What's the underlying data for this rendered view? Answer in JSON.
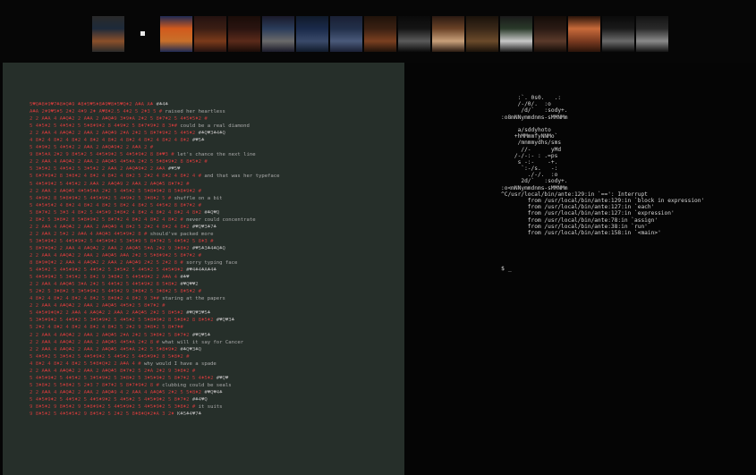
{
  "thumbnails": [
    {
      "name": "thumb-1",
      "colors": [
        "#1d2a3a",
        "#8a4f2a",
        "#2a2a2a"
      ]
    },
    {
      "name": "thumb-2",
      "colors": [
        "#060606",
        "#060606",
        "#060606"
      ]
    },
    {
      "name": "thumb-3",
      "colors": [
        "#d25a1c",
        "#c8702a",
        "#1e2a54"
      ]
    },
    {
      "name": "thumb-4",
      "colors": [
        "#3b1e14",
        "#7a3a1a",
        "#241210"
      ]
    },
    {
      "name": "thumb-5",
      "colors": [
        "#2a1410",
        "#5a2a1a",
        "#1a0c08"
      ]
    },
    {
      "name": "thumb-6",
      "colors": [
        "#2a3c5a",
        "#6a6a6a",
        "#1a1a2a"
      ]
    },
    {
      "name": "thumb-7",
      "colors": [
        "#1a2a4a",
        "#3a4a6a",
        "#101a2a"
      ]
    },
    {
      "name": "thumb-8",
      "colors": [
        "#22304a",
        "#4a5a7a",
        "#1a2034"
      ]
    },
    {
      "name": "thumb-9",
      "colors": [
        "#3a2012",
        "#7a4020",
        "#20120a"
      ]
    },
    {
      "name": "thumb-10",
      "colors": [
        "#141414",
        "#5a5a5a",
        "#0a0a0a"
      ]
    },
    {
      "name": "thumb-11",
      "colors": [
        "#6a4226",
        "#c8a07a",
        "#2a1a12"
      ]
    },
    {
      "name": "thumb-12",
      "colors": [
        "#3a2818",
        "#6a4a2a",
        "#1a120a"
      ]
    },
    {
      "name": "thumb-13",
      "colors": [
        "#2a3a2a",
        "#c8c8c8",
        "#1a1a1a"
      ]
    },
    {
      "name": "thumb-14",
      "colors": [
        "#2a1a14",
        "#5a3a2a",
        "#140c08"
      ]
    },
    {
      "name": "thumb-15",
      "colors": [
        "#c86a3a",
        "#7a3a20",
        "#2a140a"
      ]
    },
    {
      "name": "thumb-16",
      "colors": [
        "#1a1a1a",
        "#6a6a6a",
        "#0a0a0a"
      ]
    },
    {
      "name": "thumb-17",
      "colors": [
        "#2a2a2a",
        "#8a8a8a",
        "#141414"
      ]
    }
  ],
  "poem": [
    {
      "code": "5♥Q♣8♦9♥7♣8♦Q♣9 ♣8♦5♥5♦8♣9♥8♦5♥Q♦2 A♣A A♣",
      "lyric": "#♣4♣"
    },
    {
      "code": "A♣A 2♦9♥5♦5 2♦2 4♦9 2♦ A♥8♦2.5 4♦2 5 2♦3 5 #",
      "lyric": "raised her heartless"
    },
    {
      "code": "2 2 A♣A 4 A♣Q♣2 2 A♣A 2 A♣Q♣9 3♦9♦A 2♦2 5 8♦7♦2 5 4♦5♦5♦2 #",
      "lyric": ""
    },
    {
      "code": "5 4♦5♦2 5 4♦5♦2 5 5♦8♦9♦2 8 4♦9♦2 5 8♦7♦9♦2 8 3♦#",
      "lyric": "could be a real diamond"
    },
    {
      "code": "2 2 A♣A 4 A♣Q♣2 2 A♣A 2 A♣Q♣9 2♦A 2♦2 5 8♦7♦9♦2 5 4♦5♦2",
      "lyric": "#♣Q♥3♣4♣Q"
    },
    {
      "code": "4 8♦2 4 8♦2 4 8♦2 4 8♦2 4 8♦2 4 8♦2 4 8♦2 4 8♦2 4 8♦2",
      "lyric": "#♥5♣"
    },
    {
      "code": "5 4♦9♦2 5 4♦5♦2 2 A♣A 2 A♣Q♣9♦2 2 A♣A 2 #",
      "lyric": ""
    },
    {
      "code": "9 8♦5♦A 2♦2 9 8♦5♦2 5 4♦5♦9♦2 5 4♦5♦9♦2 8 8♦♥3 #",
      "lyric": "let's chance the next line"
    },
    {
      "code": "2 2 A♣A 4 A♣Q♣2 2 A♣A 2 A♣Q♣5 4♦5♦A 2♦2 5 5♦8♦9♦2 8 8♦5♦2 #",
      "lyric": ""
    },
    {
      "code": "5 3♦5♦2 5 4♦5♦2 5 3♦5♦2 2 A♣A 2 A♣Q♣9♦2 2 A♣A",
      "lyric": "#♥5♥"
    },
    {
      "code": "5 6♦7♦9♦2 8 3♦8♦2 4 8♦2 4 8♦2 4 8♦2 5 2♦2 4 8♦2 4 8♦2 4 #",
      "lyric": "and that was her typeface"
    },
    {
      "code": "5 4♦5♦9♦2 5 4♦5♦2 2 A♣A 2 A♣Q♣9 2 A♣A 2 A♣Q♣5 8♦7♦2 #",
      "lyric": ""
    },
    {
      "code": "2 2 A♣A 2 A♣Q♣5 4♦5♦5♦A 2♦2 5 4♦5♦2 5 5♦8♦9♦2 8 5♦8♦9♦2 #",
      "lyric": ""
    },
    {
      "code": "5 4♦9♦2 8 5♦8♦9♦2 5 4♦5♦9♦2 5 4♦9♦2 5 3♦8♦2 5 #",
      "lyric": "shuffle on a bit"
    },
    {
      "code": "5 4♦5♦5♦2 4 8♦2 4 8♦2 4 8♦2 5 8♦2 4 8♦2 5 4♦5♦2 8 8♦7♦2 #",
      "lyric": ""
    },
    {
      "code": "5 8♦7♦2 5 3♦3 4 8♦2 5 4♦5♦9 3♦8♦2 4 8♦2 4 8♦2 4 8♦2 4 8♦2",
      "lyric": "#♣Q♥Q"
    },
    {
      "code": "2 8♦2 5 3♦8♦2 8 5♦8♦9♦2 5 8♦7♦2 4 8♦2 4 8♦2 4 8♦2 #",
      "lyric": "never could concentrate"
    },
    {
      "code": "2 2 A♣A 4 A♣Q♣2 2 A♣A 2 A♣Q♣9 4 8♦2 5 2♦2 4 8♦2 4 8♦2",
      "lyric": "#♥Q♥3♣7♣"
    },
    {
      "code": "2 2 A♣A 2 5♦2 2 A♣A 4 A♣Q♣3 4♦5♦9♦2 8 #",
      "lyric": "should've packed more"
    },
    {
      "code": "5 3♦5♦9♦2 5 4♦5♦9♦2 5 4♦5♦9♦2 5 3♦5♦9 5 8♦7♦2 5 4♦5♦2 5 8♦3 #",
      "lyric": ""
    },
    {
      "code": "5 8♦7♦Q♦2 2 A♣A 4 A♣Q♣2 2 A♣A 2 A♣Q♣5 5♦A 2♦2 9 3♦8♦2",
      "lyric": "#♥5♣3♣4♣Q♣Q"
    },
    {
      "code": "2 2 A♣A 4 A♣Q♣2 2 A♣A 2 A♣Q♣5 A♣A 2♦2 5 5♦8♦9♦2 5 8♦7♦2 #",
      "lyric": ""
    },
    {
      "code": "8 8♦9♦Q♦2 2 A♣A 4 A♣Q♣2 2 A♣A 2 A♣Q♣9 2♦2 5 2♦2 8 #",
      "lyric": "sorry typing face"
    },
    {
      "code": "5 4♦5♦2 5 4♦5♦9♦2 5 4♦5♦2 5 3♦5♦2 5 4♦5♦2 5 4♦5♦9♦2",
      "lyric": "#♥4♣4♣A♣4♣"
    },
    {
      "code": "5 4♦5♦9♦2 5 3♦5♦2 5 8♦2 9 3♦8♦2 5 4♦5♦9♦2 2 A♣A 4",
      "lyric": "#♣♥"
    },
    {
      "code": "2 2 A♣A 4 A♣Q♣5 3♦A 2♦2 5 4♦5♦2 5 4♦5♦9♦2 8 5♦8♦2",
      "lyric": "#♥Q♥♥2"
    },
    {
      "code": "5 2♦2 5 3♦8♦2 5 3♦5♦9♦2 5 4♦5♦2 9 3♦8♦2 5 3♦8♦2 5 8♦5♦2 #",
      "lyric": ""
    },
    {
      "code": "4 8♦2 4 8♦2 4 8♦2 4 8♦2 5 8♦8♦2 4 8♦2 9 3♦#",
      "lyric": "staring at the papers"
    },
    {
      "code": "2 2 A♣A 4 A♣Q♣2 2 A♣A 2 A♣Q♣5 4♦5♦2 5 8♦7♦2 #",
      "lyric": ""
    },
    {
      "code": "5 4♦5♦9♦Q♦2 2 A♣A 4 A♣Q♣2 2 A♣A 2 A♣Q♣5 2♦2 5 8♦5♦2",
      "lyric": "#♥Q♥3♥5♣"
    },
    {
      "code": "5 3♦5♦9♦2 5 4♦5♦2 5 3♦5♦9♦2 5 4♦5♦2 5 5♦8♦9♦2 8 5♦8♦2 8 8♦5♦2",
      "lyric": "#♥Q♥3♣"
    },
    {
      "code": "5 2♦2 4 8♦2 4 8♦2 4 8♦2 4 8♦2 5 2♦2 9 3♦8♦2 5 8♦7♦#",
      "lyric": ""
    },
    {
      "code": "2 2 A♣A 4 A♣Q♣2 2 A♣A 2 A♣Q♣5 2♦A 2♦2 5 3♦8♦2 5 8♦7♦2",
      "lyric": "#♥Q♥5♣"
    },
    {
      "code": "2 2 A♣A 4 A♣Q♣2 2 A♣A 2 A♣Q♣5 4♦5♦A 2♦2 8 #",
      "lyric": "what will it say for Cancer"
    },
    {
      "code": "2 2 A♣A 4 A♣Q♣2 2 A♣A 2 A♣Q♣5 4♦5♦A 2♦2 5 5♦8♦9♦2",
      "lyric": "#♣Q♥3♣Q"
    },
    {
      "code": "5 4♦5♦2 5 3♦5♦2 5 4♦5♦9♦2 5 4♦5♦2 5 4♦5♦9♦2 8 5♦8♦2 #",
      "lyric": ""
    },
    {
      "code": "4 8♦2 4 8♦2 4 8♦2 5 5♦8♦Q♦2 2 A♣A 4 #",
      "lyric": "why would I have a spade"
    },
    {
      "code": "2 2 A♣A 4 A♣Q♣2 2 A♣A 2 A♣Q♣5 8♦7♦2 5 2♦A 2♦2 9 3♦8♦2 #",
      "lyric": ""
    },
    {
      "code": "5 4♦5♦9♦2 5 4♦5♦2 5 3♦5♦9♦2 5 3♦8♦2 5 3♦5♦9♦2 5 8♦7♦2 5 4♦5♦2",
      "lyric": "#♥Q♥"
    },
    {
      "code": "5 3♦8♦2 5 5♦8♦2 5 2♦3 7 8♦7♦2 5 8♦7♦9♦2 8 #",
      "lyric": "clubbing could be seals"
    },
    {
      "code": "2 2 A♣A 4 A♣Q♣2 2 A♣A 2 A♣Q♣9 4 2 A♣A 4 A♣Q♣5 2♦2 5 5♦8♦2",
      "lyric": "#♥Q♥4♣"
    },
    {
      "code": "5 4♦5♦9♦2 5 4♦5♦2 5 4♦5♦9♦2 5 4♦5♦2 5 4♦5♦9♦2 5 8♦7♦2",
      "lyric": "#♣4♥Q"
    },
    {
      "code": "9 8♦5♦2 9 8♦5♦2 9 5♦8♦9♦2 5 4♦5♦9♦2 5 4♦5♦9♦2 5 3♦8♦2 #",
      "lyric": "it suits"
    },
    {
      "code": "9 8♦5♦2 5 4♦5♦5♦2 9 8♦5♦2 5 2♦2 5 8♦8♦Q♦2♦A 3 2♦",
      "lyric": "K♣5♣4♥7♣"
    }
  ],
  "terminal": {
    "ascii_art": [
      "     :`. 0s0.   .:",
      "     /-/0/.  :o",
      "      /d/`   :sody+.",
      ":o8mNNymmdnms-sMMNMm",
      "",
      "     a/sddyhoto",
      "    +hMMmmfyNNMo`",
      "     /mnmmydhs/sms",
      "      //-      yMd",
      "    /-/-:- : .=ps",
      "     s -:-    -+.",
      "      `:-/s.   -:",
      "        ./-/.  :o",
      "      2d/`   :sody+.",
      ":o<mNNymmdnms-sMMNMm"
    ],
    "error_lines": [
      "^C/usr/local/bin/ante:129:in `==': Interrupt",
      "        from /usr/local/bin/ante:129:in `block in expression'",
      "        from /usr/local/bin/ante:127:in `each'",
      "        from /usr/local/bin/ante:127:in `expression'",
      "        from /usr/local/bin/ante:78:in `assign'",
      "        from /usr/local/bin/ante:38:in `run'",
      "        from /usr/local/bin/ante:158:in `<main>'"
    ],
    "prompt": "$ _"
  }
}
